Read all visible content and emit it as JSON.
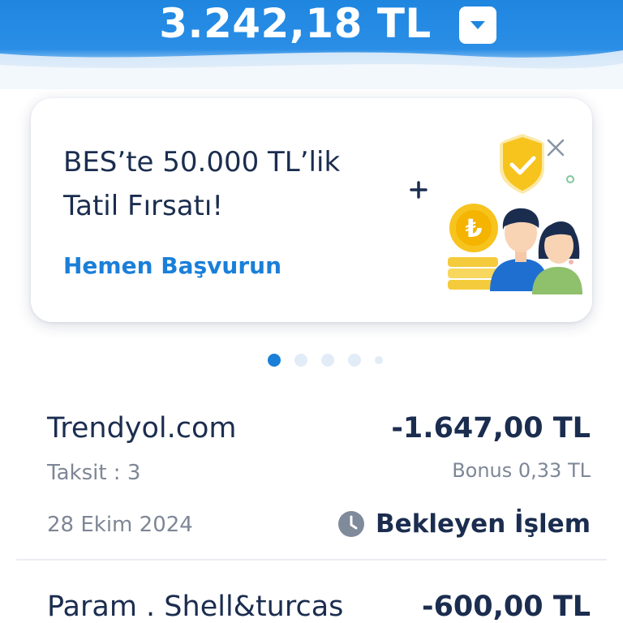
{
  "header": {
    "balance": "3.242,18 TL",
    "toggle_icon": "chevron-down-icon"
  },
  "promo": {
    "title": "BES’te 50.000 TL’lik\nTatil Fırsatı!",
    "link": "Hemen Başvurun",
    "close_icon": "close-icon",
    "illustration": "family-savings-illustration",
    "coin_symbol": "₺"
  },
  "pager": {
    "total": 5,
    "active_index": 0
  },
  "transactions": [
    {
      "merchant": "Trendyol.com",
      "amount": "-1.647,00 TL",
      "installment": "Taksit : 3",
      "bonus": "Bonus 0,33 TL",
      "date": "28 Ekim 2024",
      "status": "Bekleyen İşlem",
      "status_icon": "clock-icon"
    },
    {
      "merchant": "Param . Shell&turcas",
      "amount": "-600,00 TL"
    }
  ],
  "colors": {
    "primary": "#1a7fd8",
    "header_blue": "#1f86e0",
    "text_dark": "#1b2d4f",
    "text_muted": "#7e8796",
    "dot_inactive": "#e2ecf7"
  }
}
